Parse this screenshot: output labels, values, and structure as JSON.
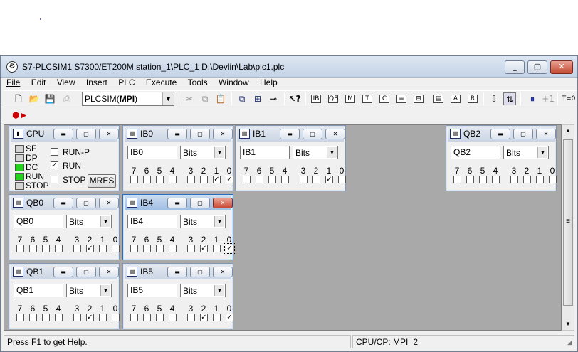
{
  "window": {
    "title": "S7-PLCSIM1    S7300/ET200M station_1\\PLC_1    D:\\Devlin\\Lab\\plc1.plc",
    "icon": "plcsim-icon",
    "minimize": "_",
    "maximize": "▢",
    "close": "✕"
  },
  "menu": [
    {
      "label": "File"
    },
    {
      "label": "Edit"
    },
    {
      "label": "View"
    },
    {
      "label": "Insert"
    },
    {
      "label": "PLC"
    },
    {
      "label": "Execute"
    },
    {
      "label": "Tools"
    },
    {
      "label": "Window"
    },
    {
      "label": "Help"
    }
  ],
  "toolbar": {
    "interface_value": "PLCSIM(",
    "interface_bold": "MPI",
    "interface_close": ")",
    "cycle_plus": "+1",
    "timer_label": "T=0"
  },
  "cpu": {
    "title": "CPU",
    "leds": [
      {
        "label": "SF",
        "on": false
      },
      {
        "label": "DP",
        "on": false
      },
      {
        "label": "DC",
        "on": true
      },
      {
        "label": "RUN",
        "on": true
      },
      {
        "label": "STOP",
        "on": false
      }
    ],
    "modes": [
      {
        "label": "RUN-P",
        "checked": false
      },
      {
        "label": "RUN",
        "checked": true
      },
      {
        "label": "STOP",
        "checked": false
      }
    ],
    "mres_label": "MRES"
  },
  "bit_labels": [
    "7",
    "6",
    "5",
    "4",
    "3",
    "2",
    "1",
    "0"
  ],
  "modules": [
    {
      "id": "ib0",
      "title": "IB0",
      "address": "IB0",
      "format": "Bits",
      "bits": [
        false,
        false,
        false,
        false,
        false,
        false,
        true,
        true
      ],
      "active": false
    },
    {
      "id": "ib1",
      "title": "IB1",
      "address": "IB1",
      "format": "Bits",
      "bits": [
        false,
        false,
        false,
        false,
        false,
        false,
        true,
        false
      ],
      "active": false
    },
    {
      "id": "qb2",
      "title": "QB2",
      "address": "QB2",
      "format": "Bits",
      "bits": [
        false,
        false,
        false,
        false,
        false,
        false,
        false,
        false
      ],
      "active": false
    },
    {
      "id": "qb0",
      "title": "QB0",
      "address": "QB0",
      "format": "Bits",
      "bits": [
        false,
        false,
        false,
        false,
        false,
        true,
        false,
        false
      ],
      "active": false
    },
    {
      "id": "ib4",
      "title": "IB4",
      "address": "IB4",
      "format": "Bits",
      "bits": [
        false,
        false,
        false,
        false,
        false,
        true,
        false,
        true
      ],
      "active": true
    },
    {
      "id": "qb1",
      "title": "QB1",
      "address": "QB1",
      "format": "Bits",
      "bits": [
        false,
        false,
        false,
        false,
        false,
        true,
        false,
        false
      ],
      "active": false
    },
    {
      "id": "ib5",
      "title": "IB5",
      "address": "IB5",
      "format": "Bits",
      "bits": [
        false,
        false,
        false,
        false,
        false,
        true,
        false,
        true
      ],
      "active": false
    }
  ],
  "status": {
    "help": "Press F1 to get Help.",
    "cpu_cp": "CPU/CP:  MPI=2"
  }
}
